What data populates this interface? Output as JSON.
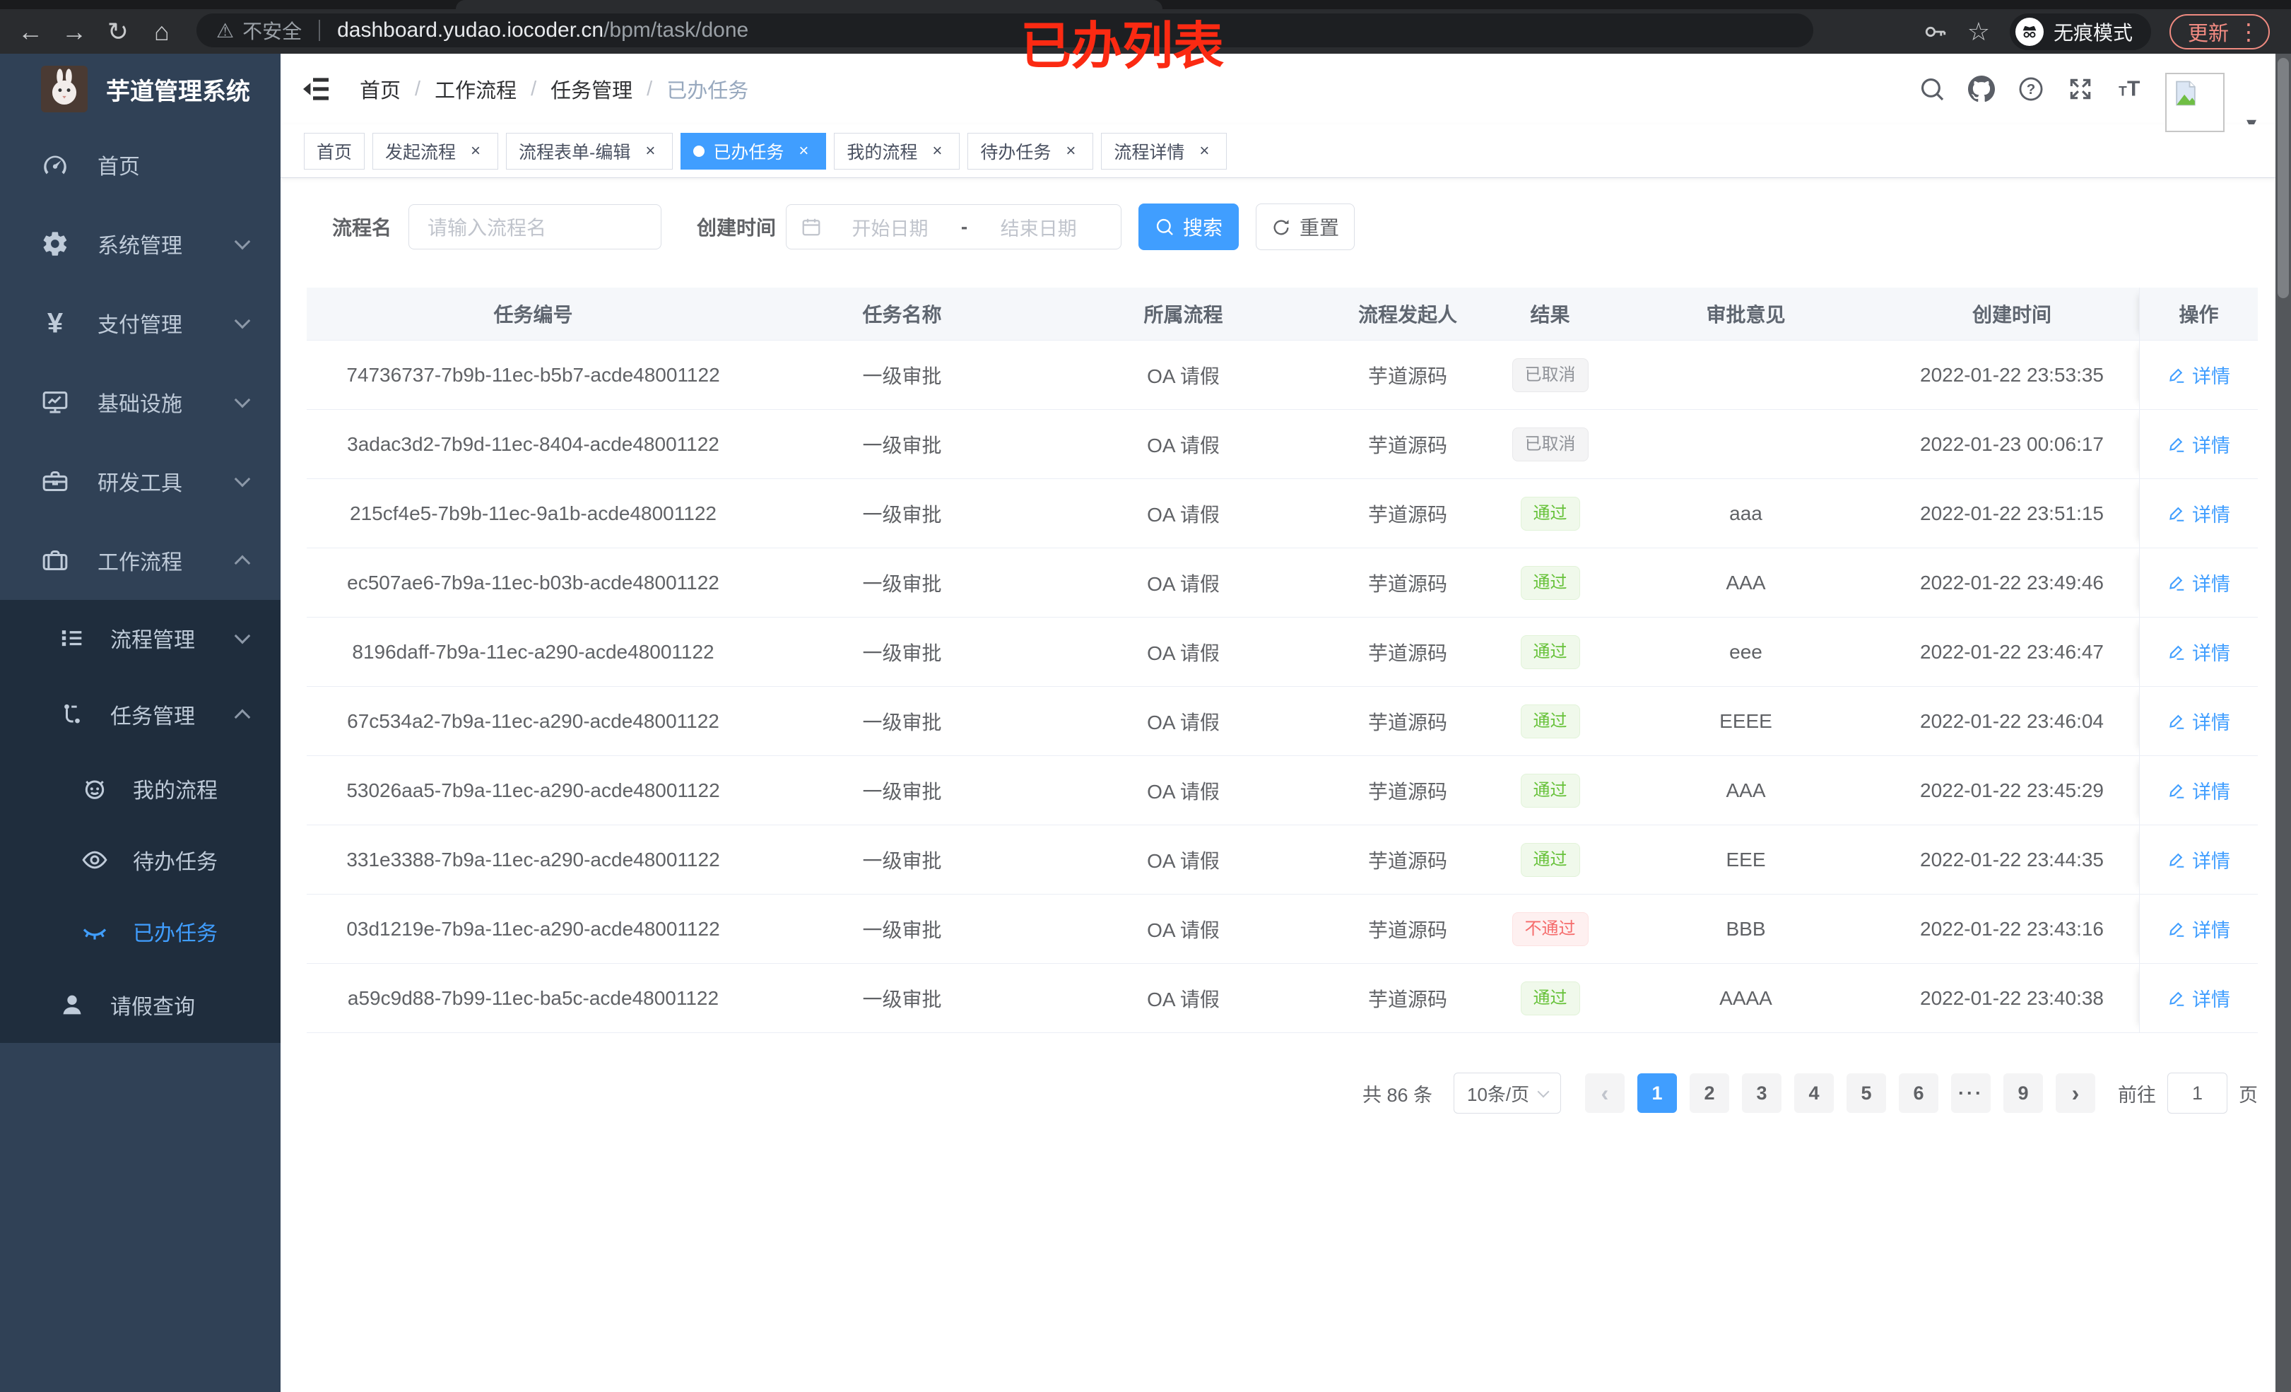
{
  "browser": {
    "security_label": "不安全",
    "url_host": "dashboard.yudao.iocoder.cn",
    "url_path": "/bpm/task/done",
    "incognito_label": "无痕模式",
    "update_label": "更新",
    "menu_dots": "⋮",
    "back": "←",
    "forward": "→",
    "reload": "↻",
    "home": "⌂",
    "warn": "⚠",
    "star": "☆"
  },
  "annotation": "已办列表",
  "sidebar": {
    "title": "芋道管理系统",
    "menu": [
      {
        "label": "首页",
        "icon": "#i-dashboard",
        "arrow": "",
        "level": 0,
        "active": false
      },
      {
        "label": "系统管理",
        "icon": "#i-gear",
        "arrow": "down",
        "level": 0,
        "active": false
      },
      {
        "label": "支付管理",
        "icon": "#i-yen",
        "arrow": "down",
        "level": 0,
        "active": false
      },
      {
        "label": "基础设施",
        "icon": "#i-monitor",
        "arrow": "down",
        "level": 0,
        "active": false
      },
      {
        "label": "研发工具",
        "icon": "#i-toolbox",
        "arrow": "down",
        "level": 0,
        "active": false
      },
      {
        "label": "工作流程",
        "icon": "#i-briefcase",
        "arrow": "up",
        "level": 0,
        "active": false
      }
    ],
    "submenu": [
      {
        "label": "流程管理",
        "icon": "#i-tree",
        "arrow": "down",
        "level": 1,
        "active": false
      },
      {
        "label": "任务管理",
        "icon": "#i-flow",
        "arrow": "up",
        "level": 1,
        "active": false
      },
      {
        "label": "我的流程",
        "icon": "#i-robot",
        "arrow": "",
        "level": 2,
        "active": false
      },
      {
        "label": "待办任务",
        "icon": "#i-eye",
        "arrow": "",
        "level": 2,
        "active": false
      },
      {
        "label": "已办任务",
        "icon": "#i-eye-closed",
        "arrow": "",
        "level": 2,
        "active": true
      },
      {
        "label": "请假查询",
        "icon": "#i-person",
        "arrow": "",
        "level": 1,
        "active": false
      }
    ]
  },
  "navbar": {
    "breadcrumb": [
      {
        "label": "首页",
        "last": false
      },
      {
        "label": "工作流程",
        "last": false
      },
      {
        "label": "任务管理",
        "last": false
      },
      {
        "label": "已办任务",
        "last": true
      }
    ]
  },
  "tags": [
    {
      "label": "首页",
      "closable": false,
      "active": false
    },
    {
      "label": "发起流程",
      "closable": true,
      "active": false
    },
    {
      "label": "流程表单-编辑",
      "closable": true,
      "active": false
    },
    {
      "label": "已办任务",
      "closable": true,
      "active": true
    },
    {
      "label": "我的流程",
      "closable": true,
      "active": false
    },
    {
      "label": "待办任务",
      "closable": true,
      "active": false
    },
    {
      "label": "流程详情",
      "closable": true,
      "active": false
    }
  ],
  "filters": {
    "name_label": "流程名",
    "name_placeholder": "请输入流程名",
    "time_label": "创建时间",
    "start_placeholder": "开始日期",
    "range_separator": "-",
    "end_placeholder": "结束日期",
    "search_label": "搜索",
    "reset_label": "重置"
  },
  "table": {
    "headers": [
      "任务编号",
      "任务名称",
      "所属流程",
      "流程发起人",
      "结果",
      "审批意见",
      "创建时间",
      "操作"
    ],
    "rows": [
      {
        "id": "74736737-7b9b-11ec-b5b7-acde48001122",
        "name": "一级审批",
        "process": "OA 请假",
        "starter": "芋道源码",
        "result": "已取消",
        "result_type": "cancelled",
        "comment": "",
        "created": "2022-01-22 23:53:35",
        "action": "详情"
      },
      {
        "id": "3adac3d2-7b9d-11ec-8404-acde48001122",
        "name": "一级审批",
        "process": "OA 请假",
        "starter": "芋道源码",
        "result": "已取消",
        "result_type": "cancelled",
        "comment": "",
        "created": "2022-01-23 00:06:17",
        "action": "详情"
      },
      {
        "id": "215cf4e5-7b9b-11ec-9a1b-acde48001122",
        "name": "一级审批",
        "process": "OA 请假",
        "starter": "芋道源码",
        "result": "通过",
        "result_type": "pass",
        "comment": "aaa",
        "created": "2022-01-22 23:51:15",
        "action": "详情"
      },
      {
        "id": "ec507ae6-7b9a-11ec-b03b-acde48001122",
        "name": "一级审批",
        "process": "OA 请假",
        "starter": "芋道源码",
        "result": "通过",
        "result_type": "pass",
        "comment": "AAA",
        "created": "2022-01-22 23:49:46",
        "action": "详情"
      },
      {
        "id": "8196daff-7b9a-11ec-a290-acde48001122",
        "name": "一级审批",
        "process": "OA 请假",
        "starter": "芋道源码",
        "result": "通过",
        "result_type": "pass",
        "comment": "eee",
        "created": "2022-01-22 23:46:47",
        "action": "详情"
      },
      {
        "id": "67c534a2-7b9a-11ec-a290-acde48001122",
        "name": "一级审批",
        "process": "OA 请假",
        "starter": "芋道源码",
        "result": "通过",
        "result_type": "pass",
        "comment": "EEEE",
        "created": "2022-01-22 23:46:04",
        "action": "详情"
      },
      {
        "id": "53026aa5-7b9a-11ec-a290-acde48001122",
        "name": "一级审批",
        "process": "OA 请假",
        "starter": "芋道源码",
        "result": "通过",
        "result_type": "pass",
        "comment": "AAA",
        "created": "2022-01-22 23:45:29",
        "action": "详情"
      },
      {
        "id": "331e3388-7b9a-11ec-a290-acde48001122",
        "name": "一级审批",
        "process": "OA 请假",
        "starter": "芋道源码",
        "result": "通过",
        "result_type": "pass",
        "comment": "EEE",
        "created": "2022-01-22 23:44:35",
        "action": "详情"
      },
      {
        "id": "03d1219e-7b9a-11ec-a290-acde48001122",
        "name": "一级审批",
        "process": "OA 请假",
        "starter": "芋道源码",
        "result": "不通过",
        "result_type": "fail",
        "comment": "BBB",
        "created": "2022-01-22 23:43:16",
        "action": "详情"
      },
      {
        "id": "a59c9d88-7b99-11ec-ba5c-acde48001122",
        "name": "一级审批",
        "process": "OA 请假",
        "starter": "芋道源码",
        "result": "通过",
        "result_type": "pass",
        "comment": "AAAA",
        "created": "2022-01-22 23:40:38",
        "action": "详情"
      }
    ]
  },
  "pagination": {
    "total_label": "共 86 条",
    "page_size": "10条/页",
    "pages": [
      {
        "label": "‹",
        "type": "prev"
      },
      {
        "label": "1",
        "type": "active"
      },
      {
        "label": "2",
        "type": "page"
      },
      {
        "label": "3",
        "type": "page"
      },
      {
        "label": "4",
        "type": "page"
      },
      {
        "label": "5",
        "type": "page"
      },
      {
        "label": "6",
        "type": "page"
      },
      {
        "label": "···",
        "type": "ellipsis"
      },
      {
        "label": "9",
        "type": "page"
      },
      {
        "label": "›",
        "type": "next"
      }
    ],
    "goto_label": "前往",
    "goto_value": "1",
    "page_unit": "页"
  },
  "colors": {
    "accent": "#409eff",
    "success": "#67c23a",
    "danger": "#f56c6c",
    "info": "#909399",
    "sidebar": "#304156",
    "sidebar_dark": "#1f2d3d"
  }
}
